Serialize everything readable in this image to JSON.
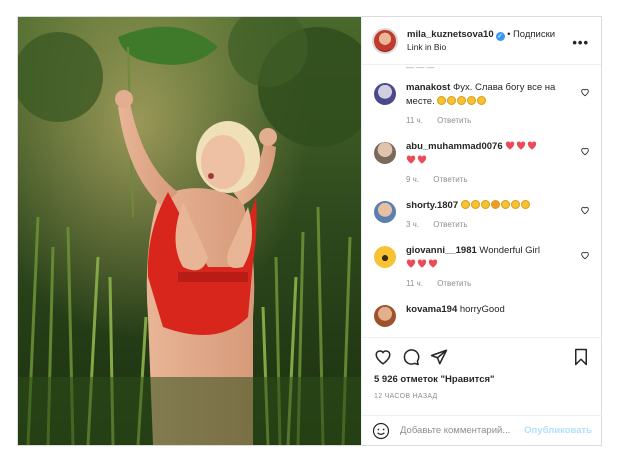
{
  "header": {
    "username": "mila_kuznetsova10",
    "verified_icon": "verified-badge-icon",
    "dot": "•",
    "follow_label": "Подписки",
    "subtitle": "Link in Bio",
    "more_icon": "more-options-icon",
    "more_glyph": "•••"
  },
  "comments": [
    {
      "user": "manakost",
      "text": "Фух. Слава богу все на месте.",
      "emojis": "clap-emoji x5",
      "time": "11 ч.",
      "reply_label": "Ответить"
    },
    {
      "user": "abu_muhammad0076",
      "text": "",
      "emojis": "red-heart-emoji x5",
      "time": "9 ч.",
      "reply_label": "Ответить"
    },
    {
      "user": "shorty.1807",
      "text": "",
      "emojis": "face-emoji x7",
      "time": "3 ч.",
      "reply_label": "Ответить"
    },
    {
      "user": "giovanni__1981",
      "text": "Wonderful Girl",
      "emojis": "red-heart-emoji x3",
      "time": "11 ч.",
      "reply_label": "Ответить"
    },
    {
      "user": "kovama194",
      "text": "horryGood"
    }
  ],
  "actions": {
    "likes": "5 926 отметок \"Нравится\"",
    "posted_ago": "12 ЧАСОВ НАЗАД"
  },
  "add_comment": {
    "placeholder": "Добавьте комментарий...",
    "post_label": "Опубликовать"
  },
  "colors": {
    "accent": "#3897f0",
    "post_disabled": "#b2dffc",
    "heart_red": "#ed4956",
    "swimsuit": "#d9261c"
  }
}
